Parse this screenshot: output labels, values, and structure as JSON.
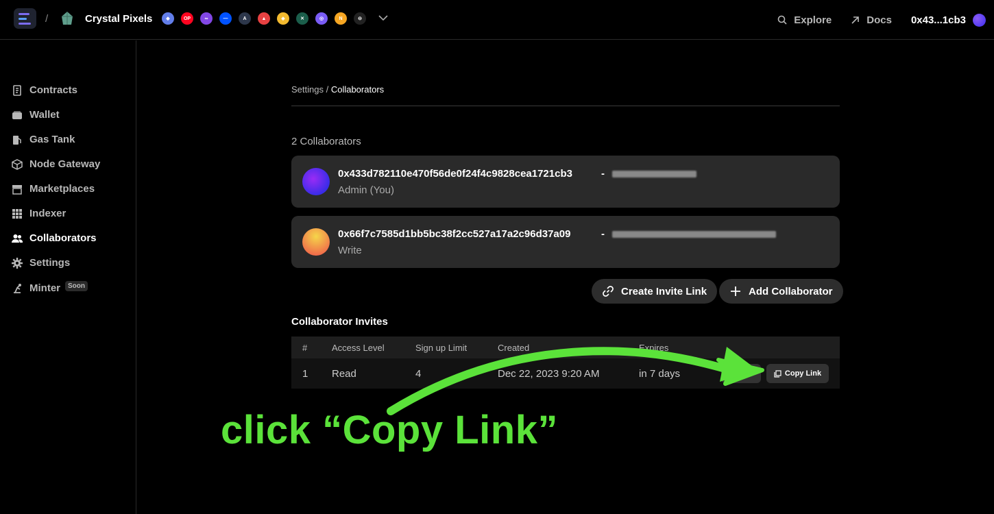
{
  "header": {
    "breadcrumb_sep": "/",
    "project_name": "Crystal Pixels",
    "chains": [
      {
        "icon": "ethereum-icon",
        "color": "#627eea",
        "glyph": "◆"
      },
      {
        "icon": "optimism-icon",
        "color": "#ff0420",
        "glyph": "OP"
      },
      {
        "icon": "polygon-icon",
        "color": "#8247e5",
        "glyph": "∞"
      },
      {
        "icon": "base-icon",
        "color": "#0052ff",
        "glyph": "—"
      },
      {
        "icon": "arbitrum-icon",
        "color": "#2d374b",
        "glyph": "A"
      },
      {
        "icon": "avalanche-icon",
        "color": "#e84142",
        "glyph": "▲"
      },
      {
        "icon": "bnb-icon",
        "color": "#f3ba2f",
        "glyph": "◈"
      },
      {
        "icon": "gnosis-icon",
        "color": "#1b5e4b",
        "glyph": "✕"
      },
      {
        "icon": "zora-icon",
        "color": "#7a5cf5",
        "glyph": "◎"
      },
      {
        "icon": "nova-icon",
        "color": "#f5a623",
        "glyph": "N"
      },
      {
        "icon": "apechain-icon",
        "color": "#222222",
        "glyph": "⊖"
      }
    ],
    "explore_label": "Explore",
    "docs_label": "Docs",
    "wallet_address": "0x43...1cb3"
  },
  "sidebar": {
    "items": [
      {
        "label": "Contracts",
        "icon": "contract-icon"
      },
      {
        "label": "Wallet",
        "icon": "wallet-icon"
      },
      {
        "label": "Gas Tank",
        "icon": "gas-pump-icon"
      },
      {
        "label": "Node Gateway",
        "icon": "cube-icon"
      },
      {
        "label": "Marketplaces",
        "icon": "store-icon"
      },
      {
        "label": "Indexer",
        "icon": "grid-icon"
      },
      {
        "label": "Collaborators",
        "icon": "users-icon"
      },
      {
        "label": "Settings",
        "icon": "gear-icon"
      },
      {
        "label": "Minter",
        "icon": "minter-icon",
        "badge": "Soon"
      }
    ],
    "active": "Collaborators"
  },
  "main": {
    "breadcrumb_parent": "Settings",
    "breadcrumb_sep": " / ",
    "breadcrumb_current": "Collaborators",
    "collaborator_count": "2 Collaborators",
    "collaborators": [
      {
        "address": "0x433d782110e470f56de0f24f4c9828cea1721cb3",
        "separator": "-",
        "role": "Admin (You)"
      },
      {
        "address": "0x66f7c7585d1bb5bc38f2cc527a17a2c96d37a09",
        "separator": "-",
        "role": "Write"
      }
    ],
    "create_invite_label": "Create Invite Link",
    "add_collaborator_label": "Add Collaborator",
    "invites_title": "Collaborator Invites",
    "table": {
      "headers": [
        "#",
        "Access Level",
        "Sign up Limit",
        "Created",
        "Expires"
      ],
      "rows": [
        {
          "num": "1",
          "access": "Read",
          "limit": "4",
          "created": "Dec 22, 2023 9:20 AM",
          "expires": "in 7 days",
          "delete_label": "Delete",
          "copy_label": "Copy Link"
        }
      ]
    }
  },
  "annotation": {
    "text": "click “Copy Link”",
    "color": "#5be23a"
  }
}
